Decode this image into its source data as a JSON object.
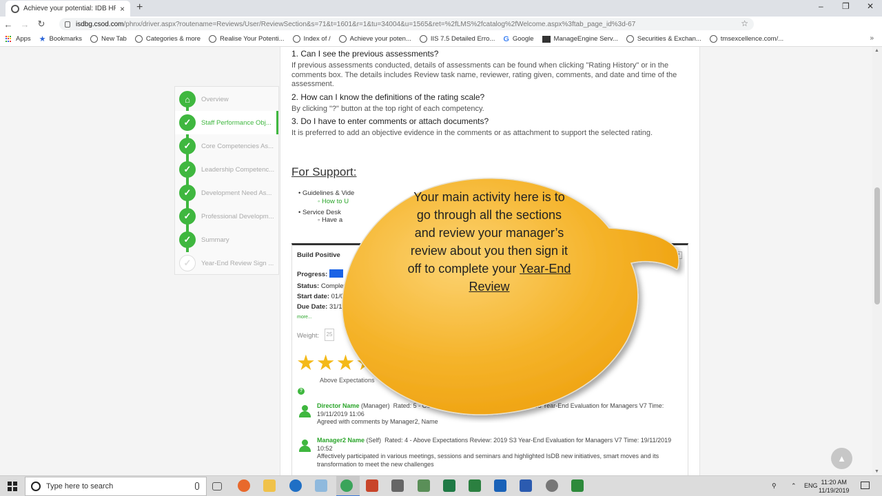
{
  "browser": {
    "tab_title": "Achieve your potential: IDB HRM",
    "tab_close": "×",
    "new_tab": "+",
    "url_host": "isdbg.csod.com",
    "url_rest": "/phnx/driver.aspx?routename=Reviews/User/ReviewSection&s=71&t=1601&r=1&tu=34004&u=1565&ret=%2fLMS%2fcatalog%2fWelcome.aspx%3ftab_page_id%3d-67",
    "window_controls": [
      "–",
      "❐",
      "✕"
    ],
    "bookmarks": [
      {
        "label": "Apps",
        "icon": "apps-grid-icon"
      },
      {
        "label": "Bookmarks",
        "icon": "star-icon"
      },
      {
        "label": "New Tab",
        "icon": "globe-icon"
      },
      {
        "label": "Categories & more",
        "icon": "globe-icon"
      },
      {
        "label": "Realise Your Potenti...",
        "icon": "globe-icon"
      },
      {
        "label": "Index of /",
        "icon": "globe-icon"
      },
      {
        "label": "Achieve your poten...",
        "icon": "globe-icon"
      },
      {
        "label": "IIS 7.5 Detailed Erro...",
        "icon": "globe-icon"
      },
      {
        "label": "Google",
        "icon": "google-icon"
      },
      {
        "label": "ManageEngine Serv...",
        "icon": "manageengine-icon"
      },
      {
        "label": "Securities & Exchan...",
        "icon": "globe-icon"
      },
      {
        "label": "tmsexcellence.com/...",
        "icon": "globe-icon"
      }
    ],
    "bookmarks_more": "»"
  },
  "steps": [
    {
      "label": "Overview",
      "state": "done",
      "icon": "home-icon"
    },
    {
      "label": "Staff Performance Obj...",
      "state": "active",
      "icon": "check-icon"
    },
    {
      "label": "Core Competencies As...",
      "state": "done",
      "icon": "check-icon"
    },
    {
      "label": "Leadership Competenc...",
      "state": "done",
      "icon": "check-icon"
    },
    {
      "label": "Development Need As...",
      "state": "done",
      "icon": "check-icon"
    },
    {
      "label": "Professional Developm...",
      "state": "done",
      "icon": "check-icon"
    },
    {
      "label": "Summary",
      "state": "done",
      "icon": "check-icon"
    },
    {
      "label": "Year-End Review Sign ...",
      "state": "pending",
      "icon": "check-icon"
    }
  ],
  "faq": {
    "q1": "1. Can I see the previous assessments?",
    "a1": "If previous assessments conducted, details of assessments can be found when clicking \"Rating History\" or in the comments box. The details includes Review task name, reviewer, rating given, comments, and date and time of the assessment.",
    "q2": "2. How can I know the definitions of the rating scale?",
    "a2": "By clicking \"?\" button at the top right of each competency.",
    "q3": "3. Do I have to enter comments or attach documents?",
    "a3": "It is preferred to add an objective evidence in the comments or as attachment to support the selected rating."
  },
  "support": {
    "heading": "For Support:",
    "item1": "Guidelines & Vide",
    "item1_link": "How to U",
    "item2": "Service Desk",
    "item2_sub": "Have a"
  },
  "card": {
    "title": "Build Positive",
    "progress_label": "Progress:",
    "progress": 0.1,
    "status_label": "Status:",
    "status_value": "Complete",
    "start_label": "Start date:",
    "start_value": "01/01/",
    "due_label": "Due Date:",
    "due_value": "31/12/20",
    "more": "more...",
    "weight_label": "Weight:",
    "weight_value": "25",
    "weight_unit": "%",
    "rating_stars": 4,
    "rating_max": 5,
    "rating_label": "Above Expectations",
    "help": "?",
    "comments": [
      {
        "name": "Director Name",
        "role": "(Manager)",
        "meta": "Rated: 5 - Outstanding Performance   Review: 2019 S3 Year-End Evaluation for Managers V7   Time: 19/11/2019 11:06",
        "body": "Agreed with comments by Manager2, Name"
      },
      {
        "name": "Manager2 Name",
        "role": "(Self)",
        "meta": "Rated: 4 - Above Expectations   Review: 2019 S3 Year-End Evaluation for Managers V7   Time: 19/11/2019 10:52",
        "body": "Affectively participated in various meetings, sessions and seminars and highlighted IsDB new initiatives,   smart moves and its transformation to meet the new challenges"
      }
    ]
  },
  "bubble": {
    "text": "Your main activity here is to go through all the sections and review your manager’s review about you then sign it off to complete your ",
    "link_text": "Year-End Review"
  },
  "taskbar": {
    "search_placeholder": "Type here to search",
    "lang": "ENG",
    "time": "11:20 AM",
    "date": "11/19/2019",
    "apps": [
      {
        "icon": "task-view-icon",
        "color": "#555"
      },
      {
        "icon": "firefox-icon",
        "color": "#e8692c"
      },
      {
        "icon": "file-explorer-icon",
        "color": "#f0c24a"
      },
      {
        "icon": "edge-icon",
        "color": "#1f6fc5"
      },
      {
        "icon": "notepad-icon",
        "color": "#8fb9dd"
      },
      {
        "icon": "chrome-icon",
        "color": "#3aa45a"
      },
      {
        "icon": "powerpoint-icon",
        "color": "#c8452a"
      },
      {
        "icon": "tools-icon",
        "color": "#666"
      },
      {
        "icon": "server-manager-icon",
        "color": "#5a8f58"
      },
      {
        "icon": "excel-icon",
        "color": "#1f7a45"
      },
      {
        "icon": "project-icon",
        "color": "#2b8040"
      },
      {
        "icon": "outlook-icon",
        "color": "#1a62b8"
      },
      {
        "icon": "word-icon",
        "color": "#2b5bb0"
      },
      {
        "icon": "satellite-icon",
        "color": "#777"
      },
      {
        "icon": "camtasia-icon",
        "color": "#2d8a3b"
      }
    ]
  },
  "colors": {
    "accent_green": "#3fb73f",
    "bubble_orange": "#f2a71a",
    "progress_blue": "#1a63e6",
    "star_gold": "#f4b919"
  }
}
